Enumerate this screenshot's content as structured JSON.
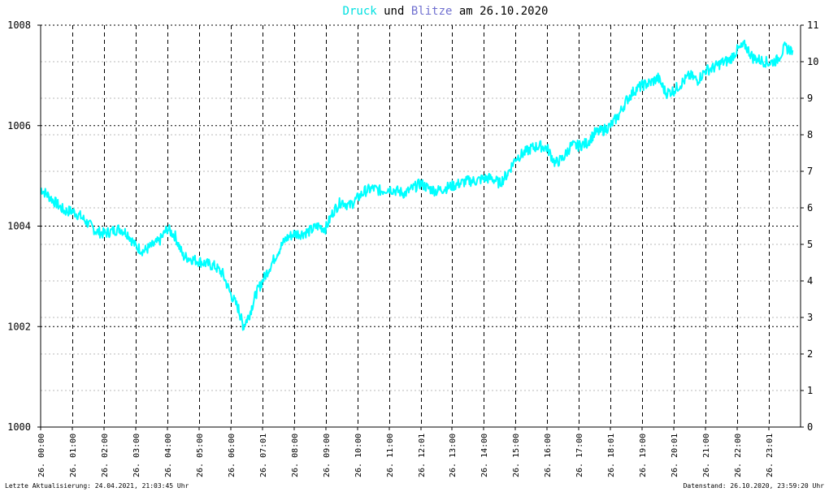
{
  "title": {
    "part1": "Druck",
    "part2": " und ",
    "part3": "Blitze",
    "part4": " am 26.10.2020",
    "color1": "#00e0e0",
    "color2": "#000000",
    "color3": "#7070d0",
    "color4": "#000000"
  },
  "footer": {
    "left": "Letzte Aktualisierung: 24.04.2021, 21:03:45 Uhr",
    "right": "Datenstand: 26.10.2020, 23:59:20 Uhr"
  },
  "chart_data": {
    "type": "line",
    "title": "Druck und Blitze am 26.10.2020",
    "y_left": {
      "ylim": [
        1000,
        1008
      ],
      "ticks": [
        1000,
        1002,
        1004,
        1006,
        1008
      ]
    },
    "y_right": {
      "ylim": [
        0,
        11
      ],
      "ticks": [
        0,
        1,
        2,
        3,
        4,
        5,
        6,
        7,
        8,
        9,
        10,
        11
      ]
    },
    "x_range_hours": [
      0,
      24
    ],
    "x_ticks": [
      {
        "h": 0,
        "label": "26. 00:00"
      },
      {
        "h": 1,
        "label": "26. 01:00"
      },
      {
        "h": 2,
        "label": "26. 02:00"
      },
      {
        "h": 3,
        "label": "26. 03:00"
      },
      {
        "h": 4,
        "label": "26. 04:00"
      },
      {
        "h": 5,
        "label": "26. 05:00"
      },
      {
        "h": 6,
        "label": "26. 06:00"
      },
      {
        "h": 7,
        "label": "26. 07:01"
      },
      {
        "h": 8,
        "label": "26. 08:00"
      },
      {
        "h": 9,
        "label": "26. 09:00"
      },
      {
        "h": 10,
        "label": "26. 10:00"
      },
      {
        "h": 11,
        "label": "26. 11:00"
      },
      {
        "h": 12,
        "label": "26. 12:01"
      },
      {
        "h": 13,
        "label": "26. 13:00"
      },
      {
        "h": 14,
        "label": "26. 14:00"
      },
      {
        "h": 15,
        "label": "26. 15:00"
      },
      {
        "h": 16,
        "label": "26. 16:00"
      },
      {
        "h": 17,
        "label": "26. 17:00"
      },
      {
        "h": 18,
        "label": "26. 18:01"
      },
      {
        "h": 19,
        "label": "26. 19:00"
      },
      {
        "h": 20,
        "label": "26. 20:01"
      },
      {
        "h": 21,
        "label": "26. 21:00"
      },
      {
        "h": 22,
        "label": "26. 22:00"
      },
      {
        "h": 23,
        "label": "26. 23:01"
      }
    ],
    "series": [
      {
        "name": "Druck",
        "color": "#00ffff",
        "axis": "left",
        "points": [
          [
            0.0,
            1004.75
          ],
          [
            0.25,
            1004.6
          ],
          [
            0.5,
            1004.45
          ],
          [
            0.75,
            1004.3
          ],
          [
            1.0,
            1004.3
          ],
          [
            1.25,
            1004.2
          ],
          [
            1.5,
            1004.05
          ],
          [
            1.75,
            1003.9
          ],
          [
            2.0,
            1003.85
          ],
          [
            2.25,
            1003.9
          ],
          [
            2.5,
            1003.95
          ],
          [
            2.75,
            1003.85
          ],
          [
            3.0,
            1003.6
          ],
          [
            3.25,
            1003.5
          ],
          [
            3.5,
            1003.6
          ],
          [
            3.75,
            1003.7
          ],
          [
            4.0,
            1003.95
          ],
          [
            4.25,
            1003.8
          ],
          [
            4.5,
            1003.4
          ],
          [
            4.75,
            1003.35
          ],
          [
            5.0,
            1003.3
          ],
          [
            5.25,
            1003.25
          ],
          [
            5.5,
            1003.2
          ],
          [
            5.75,
            1003.05
          ],
          [
            6.0,
            1002.65
          ],
          [
            6.25,
            1002.35
          ],
          [
            6.4,
            1002.0
          ],
          [
            6.6,
            1002.25
          ],
          [
            6.8,
            1002.65
          ],
          [
            7.0,
            1002.9
          ],
          [
            7.25,
            1003.2
          ],
          [
            7.5,
            1003.5
          ],
          [
            7.75,
            1003.75
          ],
          [
            8.0,
            1003.85
          ],
          [
            8.25,
            1003.85
          ],
          [
            8.5,
            1003.9
          ],
          [
            8.75,
            1004.0
          ],
          [
            9.0,
            1003.95
          ],
          [
            9.25,
            1004.3
          ],
          [
            9.5,
            1004.5
          ],
          [
            9.75,
            1004.4
          ],
          [
            10.0,
            1004.55
          ],
          [
            10.25,
            1004.7
          ],
          [
            10.5,
            1004.75
          ],
          [
            10.75,
            1004.7
          ],
          [
            11.0,
            1004.75
          ],
          [
            11.25,
            1004.7
          ],
          [
            11.5,
            1004.65
          ],
          [
            11.75,
            1004.75
          ],
          [
            12.0,
            1004.85
          ],
          [
            12.25,
            1004.75
          ],
          [
            12.5,
            1004.7
          ],
          [
            12.75,
            1004.75
          ],
          [
            13.0,
            1004.8
          ],
          [
            13.25,
            1004.85
          ],
          [
            13.5,
            1004.9
          ],
          [
            13.75,
            1004.9
          ],
          [
            14.0,
            1004.95
          ],
          [
            14.25,
            1004.95
          ],
          [
            14.5,
            1004.85
          ],
          [
            14.75,
            1005.05
          ],
          [
            15.0,
            1005.35
          ],
          [
            15.25,
            1005.45
          ],
          [
            15.5,
            1005.55
          ],
          [
            15.75,
            1005.6
          ],
          [
            16.0,
            1005.55
          ],
          [
            16.25,
            1005.25
          ],
          [
            16.5,
            1005.35
          ],
          [
            16.75,
            1005.6
          ],
          [
            17.0,
            1005.6
          ],
          [
            17.25,
            1005.65
          ],
          [
            17.5,
            1005.85
          ],
          [
            17.75,
            1005.9
          ],
          [
            18.0,
            1006.0
          ],
          [
            18.25,
            1006.2
          ],
          [
            18.5,
            1006.5
          ],
          [
            18.75,
            1006.7
          ],
          [
            19.0,
            1006.8
          ],
          [
            19.25,
            1006.85
          ],
          [
            19.5,
            1006.95
          ],
          [
            19.75,
            1006.65
          ],
          [
            20.0,
            1006.7
          ],
          [
            20.25,
            1006.85
          ],
          [
            20.5,
            1007.0
          ],
          [
            20.75,
            1006.9
          ],
          [
            21.0,
            1007.1
          ],
          [
            21.25,
            1007.15
          ],
          [
            21.5,
            1007.25
          ],
          [
            21.75,
            1007.3
          ],
          [
            22.0,
            1007.5
          ],
          [
            22.25,
            1007.6
          ],
          [
            22.5,
            1007.35
          ],
          [
            22.75,
            1007.3
          ],
          [
            23.0,
            1007.25
          ],
          [
            23.25,
            1007.3
          ],
          [
            23.5,
            1007.55
          ],
          [
            23.75,
            1007.5
          ]
        ]
      }
    ]
  }
}
